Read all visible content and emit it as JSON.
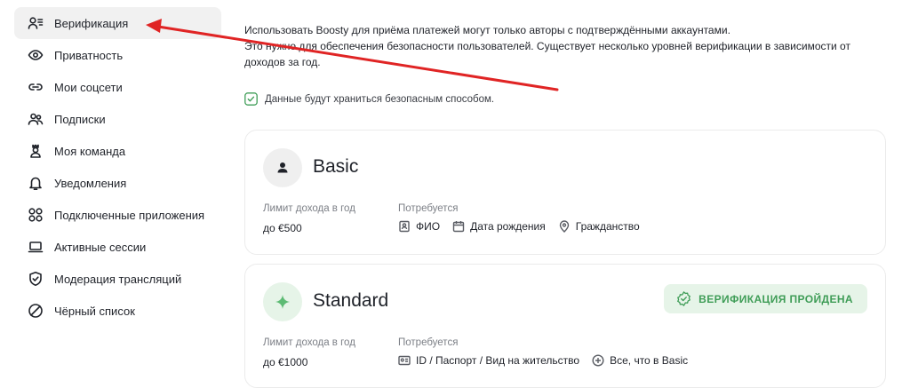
{
  "sidebar": {
    "items": [
      {
        "label": "Верификация",
        "icon": "verification-icon",
        "active": true
      },
      {
        "label": "Приватность",
        "icon": "eye-icon"
      },
      {
        "label": "Мои соцсети",
        "icon": "link-icon"
      },
      {
        "label": "Подписки",
        "icon": "subscribers-icon"
      },
      {
        "label": "Моя команда",
        "icon": "team-icon"
      },
      {
        "label": "Уведомления",
        "icon": "bell-icon"
      },
      {
        "label": "Подключенные приложения",
        "icon": "apps-icon"
      },
      {
        "label": "Активные сессии",
        "icon": "laptop-icon"
      },
      {
        "label": "Модерация трансляций",
        "icon": "shield-check-icon"
      },
      {
        "label": "Чёрный список",
        "icon": "block-icon"
      }
    ]
  },
  "intro": {
    "line1": "Использовать Boosty для приёма платежей могут только авторы с подтверждёнными аккаунтами.",
    "line2": "Это нужно для обеспечения безопасности пользователей. Существует несколько уровней верификации в зависимости от",
    "line3": "доходов за год."
  },
  "secure_note": "Данные будут храниться безопасным способом.",
  "tiers": {
    "basic": {
      "name": "Basic",
      "limit_label": "Лимит дохода в год",
      "limit_value": "до €500",
      "requires_label": "Потребуется",
      "requirements": [
        "ФИО",
        "Дата рождения",
        "Гражданство"
      ]
    },
    "standard": {
      "name": "Standard",
      "badge": "ВЕРИФИКАЦИЯ ПРОЙДЕНА",
      "limit_label": "Лимит дохода в год",
      "limit_value": "до €1000",
      "requires_label": "Потребуется",
      "requirements": [
        "ID / Паспорт / Вид на жительство",
        "Все, что в Basic"
      ]
    }
  },
  "colors": {
    "accent_green": "#3f9d57",
    "badge_bg": "#e6f4e8",
    "annotation_arrow": "#e02424",
    "active_bg": "#f1f1f1"
  }
}
